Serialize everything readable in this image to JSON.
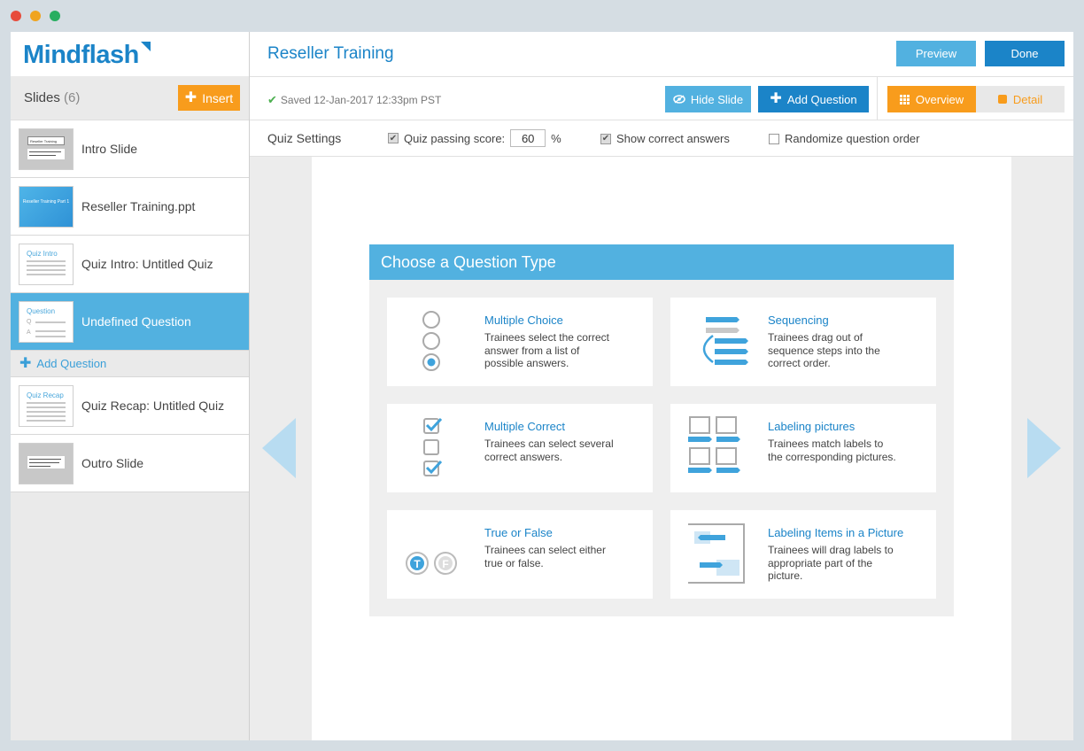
{
  "window": {
    "dot_colors": [
      "#e74c3c",
      "#f0a41f",
      "#27ae60"
    ]
  },
  "sidebar": {
    "logo": "Mindflash",
    "slides_title": "Slides",
    "slides_count": "(6)",
    "insert_label": "Insert",
    "add_question_label": "Add Question",
    "slides": [
      {
        "label": "Intro Slide",
        "thumb": "gray",
        "thumb_text": "Reseller Training"
      },
      {
        "label": "Reseller Training.ppt",
        "thumb": "blue",
        "thumb_text": "Reseller Training Part 1"
      },
      {
        "label": "Quiz Intro: Untitled Quiz",
        "thumb": "white",
        "thumb_text": "Quiz Intro"
      },
      {
        "label": "Undefined Question",
        "thumb": "white",
        "thumb_text": "Question",
        "active": true
      },
      {
        "label": "Quiz Recap: Untitled Quiz",
        "thumb": "white",
        "thumb_text": "Quiz Recap"
      },
      {
        "label": "Outro Slide",
        "thumb": "gray",
        "thumb_text": ""
      }
    ]
  },
  "header": {
    "title": "Reseller Training",
    "preview_label": "Preview",
    "done_label": "Done"
  },
  "toolbar": {
    "saved_text": "Saved 12-Jan-2017 12:33pm PST",
    "hide_slide_label": "Hide Slide",
    "add_question_label": "Add Question",
    "overview_label": "Overview",
    "detail_label": "Detail"
  },
  "quiz_settings": {
    "label": "Quiz Settings",
    "passing_score_label": "Quiz passing score:",
    "passing_score_value": "60",
    "percent": "%",
    "show_correct_label": "Show correct answers",
    "randomize_label": "Randomize question order"
  },
  "dialog": {
    "title": "Choose a Question Type",
    "types": [
      {
        "title": "Multiple Choice",
        "desc": "Trainees select the correct answer from a list of possible answers.",
        "icon": "radio-list-icon"
      },
      {
        "title": "Sequencing",
        "desc": "Trainees drag out of sequence steps into the correct order.",
        "icon": "sequence-icon"
      },
      {
        "title": "Multiple Correct",
        "desc": "Trainees can select several correct answers.",
        "icon": "checkbox-list-icon"
      },
      {
        "title": "Labeling pictures",
        "desc": "Trainees match labels to the corresponding pictures.",
        "icon": "label-grid-icon"
      },
      {
        "title": "True or False",
        "desc": "Trainees can select either true or false.",
        "icon": "true-false-icon"
      },
      {
        "title": "Labeling Items in a Picture",
        "desc": "Trainees will drag labels to appropriate part of the picture.",
        "icon": "label-picture-icon"
      }
    ]
  },
  "colors": {
    "primary": "#1b84c8",
    "light_blue": "#52b1e0",
    "orange": "#f89c1c"
  }
}
